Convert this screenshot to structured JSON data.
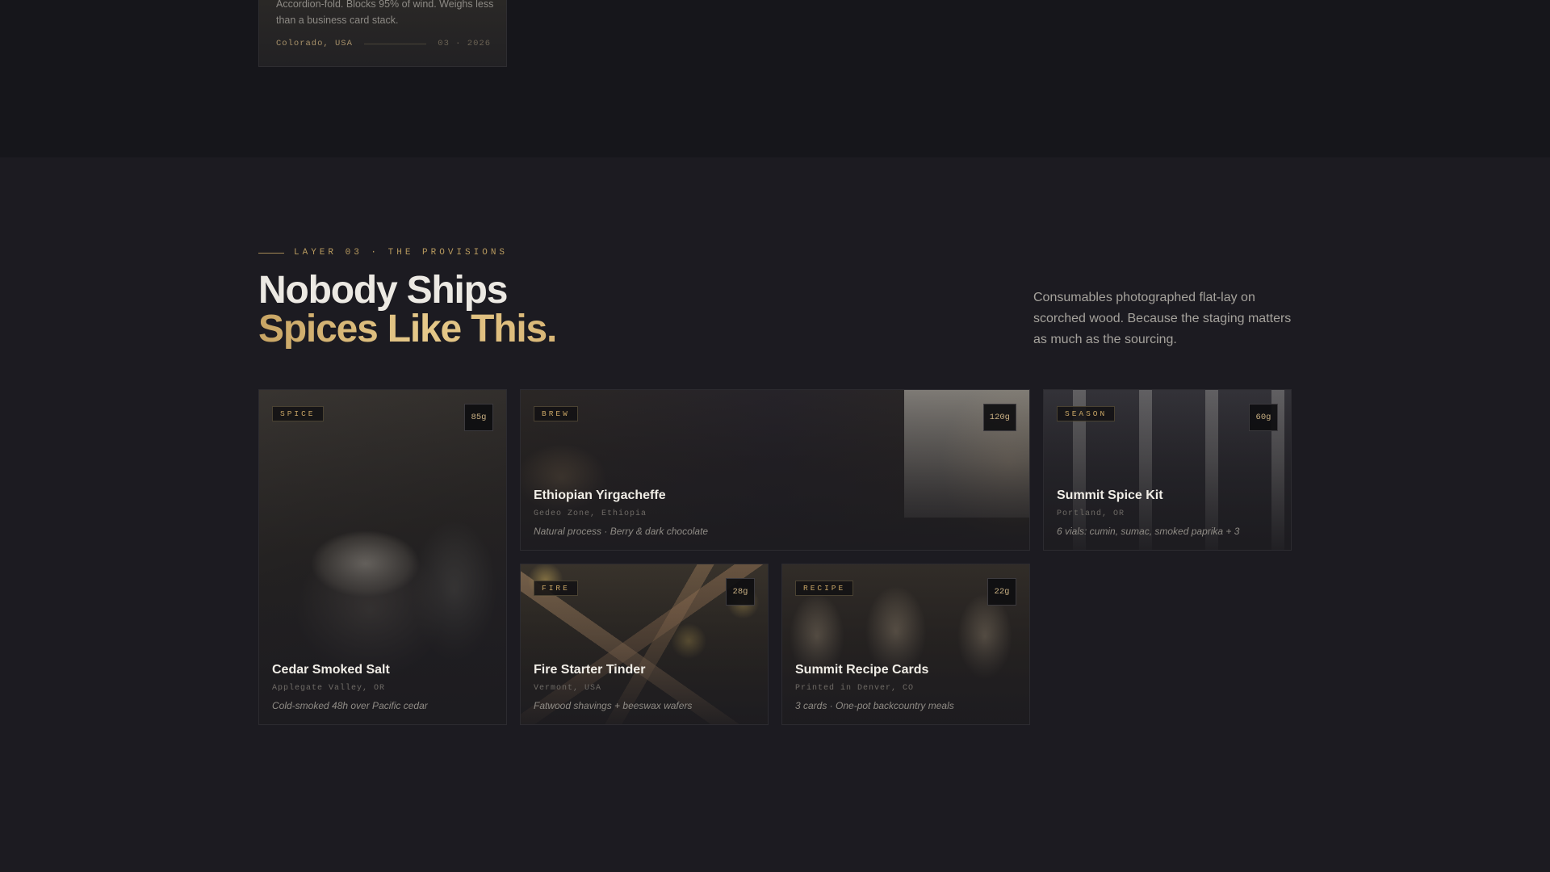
{
  "previous_card": {
    "description": "Accordion-fold. Blocks 95% of wind. Weighs less than a business card stack.",
    "location": "Colorado, USA",
    "date": "03 · 2026"
  },
  "section": {
    "eyebrow": "LAYER 03 · THE PROVISIONS",
    "headline_line1": "Nobody Ships",
    "headline_line2": "Spices Like This.",
    "intro": "Consumables photographed flat-lay on scorched wood. Because the staging matters as much as the sourcing."
  },
  "products": [
    {
      "tag": "SPICE",
      "weight": "85g",
      "name": "Cedar Smoked Salt",
      "origin": "Applegate Valley, OR",
      "detail": "Cold-smoked 48h over Pacific cedar"
    },
    {
      "tag": "BREW",
      "weight": "120g",
      "name": "Ethiopian Yirgacheffe",
      "origin": "Gedeo Zone, Ethiopia",
      "detail": "Natural process · Berry & dark chocolate"
    },
    {
      "tag": "SEASON",
      "weight": "60g",
      "name": "Summit Spice Kit",
      "origin": "Portland, OR",
      "detail": "6 vials: cumin, sumac, smoked paprika + 3"
    },
    {
      "tag": "FIRE",
      "weight": "28g",
      "name": "Fire Starter Tinder",
      "origin": "Vermont, USA",
      "detail": "Fatwood shavings + beeswax wafers"
    },
    {
      "tag": "RECIPE",
      "weight": "22g",
      "name": "Summit Recipe Cards",
      "origin": "Printed in Denver, CO",
      "detail": "3 cards · One-pot backcountry meals"
    }
  ],
  "colors": {
    "background": "#1c1b21",
    "accent_gold": "#c8a565",
    "top_band": "#16161b"
  }
}
